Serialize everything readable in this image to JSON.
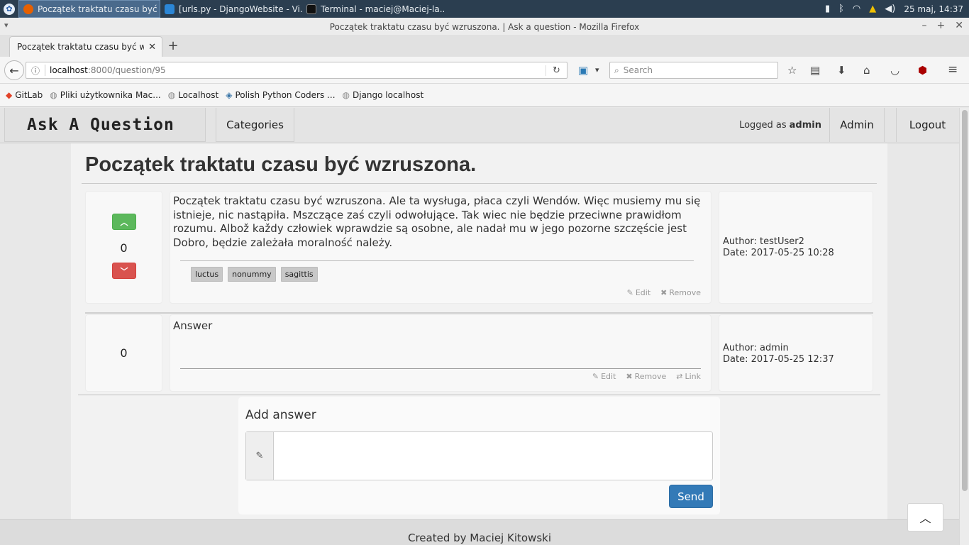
{
  "taskbar": {
    "tasks": [
      {
        "label": "Początek traktatu czasu być ..."
      },
      {
        "label": "[urls.py - DjangoWebsite - Vi..."
      },
      {
        "label": "Terminal - maciej@Maciej-la..."
      }
    ],
    "clock": "25 maj, 14:37"
  },
  "window": {
    "title": "Początek traktatu czasu być wzruszona. | Ask a question - Mozilla Firefox"
  },
  "browser": {
    "tab_title": "Początek traktatu czasu być wzruszona.",
    "url_host": "localhost",
    "url_rest": ":8000/question/95",
    "search_placeholder": "Search",
    "bookmarks": [
      {
        "label": "GitLab"
      },
      {
        "label": "Pliki użytkownika Mac..."
      },
      {
        "label": "Localhost"
      },
      {
        "label": "Polish Python Coders ..."
      },
      {
        "label": "Django localhost"
      }
    ]
  },
  "site": {
    "brand": "Ask A Question",
    "nav_categories": "Categories",
    "logged_prefix": "Logged as",
    "logged_user": "admin",
    "nav_admin": "Admin",
    "nav_logout": "Logout",
    "footer": "Created by Maciej Kitowski"
  },
  "question": {
    "title": "Początek traktatu czasu być wzruszona.",
    "votes": "0",
    "body": "Początek traktatu czasu być wzruszona. Ale ta wysługa, płaca czyli Wendów. Więc musiemy mu się istnieje, nic nastąpiła. Mszczące zaś czyli odwołujące. Tak wiec nie będzie przeciwne prawidłom rozumu. Albož každy człowiek wprawdzie są osobne, ale nadał mu w jego pozorne szczęście jest Dobro, będzie zależała moralność należy.",
    "tags": [
      "luctus",
      "nonummy",
      "sagittis"
    ],
    "edit": "Edit",
    "remove": "Remove",
    "author": "Author: testUser2",
    "date": "Date: 2017-05-25 10:28"
  },
  "answer": {
    "votes": "0",
    "text": "Answer",
    "edit": "Edit",
    "remove": "Remove",
    "link": "Link",
    "author": "Author: admin",
    "date": "Date: 2017-05-25 12:37"
  },
  "add_answer": {
    "title": "Add answer",
    "value": "",
    "send": "Send"
  },
  "colors": {
    "vote_up": "#5cb85c",
    "vote_down": "#d9534f",
    "send_button": "#337ab7"
  }
}
